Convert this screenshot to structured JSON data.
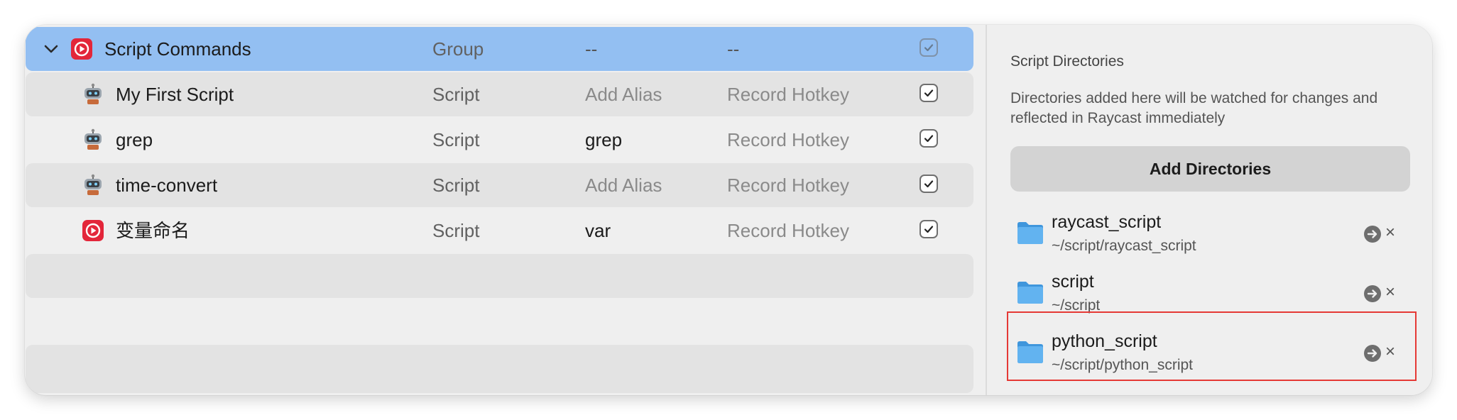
{
  "commands": {
    "group": {
      "name": "Script Commands",
      "type": "Group",
      "alias": "--",
      "hotkey": "--",
      "icon": "raycast-script-commands-icon"
    },
    "items": [
      {
        "name": "My First Script",
        "type": "Script",
        "alias": "Add Alias",
        "hotkey": "Record Hotkey",
        "icon": "robot-icon"
      },
      {
        "name": "grep",
        "type": "Script",
        "alias": "grep",
        "hotkey": "Record Hotkey",
        "icon": "robot-icon"
      },
      {
        "name": "time-convert",
        "type": "Script",
        "alias": "Add Alias",
        "hotkey": "Record Hotkey",
        "icon": "robot-icon"
      },
      {
        "name": "变量命名",
        "type": "Script",
        "alias": "var",
        "hotkey": "Record Hotkey",
        "icon": "raycast-script-icon"
      }
    ]
  },
  "directories": {
    "title": "Script Directories",
    "description": "Directories added here will be watched for changes and reflected in Raycast immediately",
    "add_button": "Add Directories",
    "items": [
      {
        "name": "raycast_script",
        "path": "~/script/raycast_script"
      },
      {
        "name": "script",
        "path": "~/script"
      },
      {
        "name": "python_script",
        "path": "~/script/python_script"
      }
    ]
  },
  "colors": {
    "selection": "#93bff2",
    "accent_red": "#e3263a",
    "folder_blue": "#4aa3e8",
    "highlight_border": "#e53935"
  }
}
